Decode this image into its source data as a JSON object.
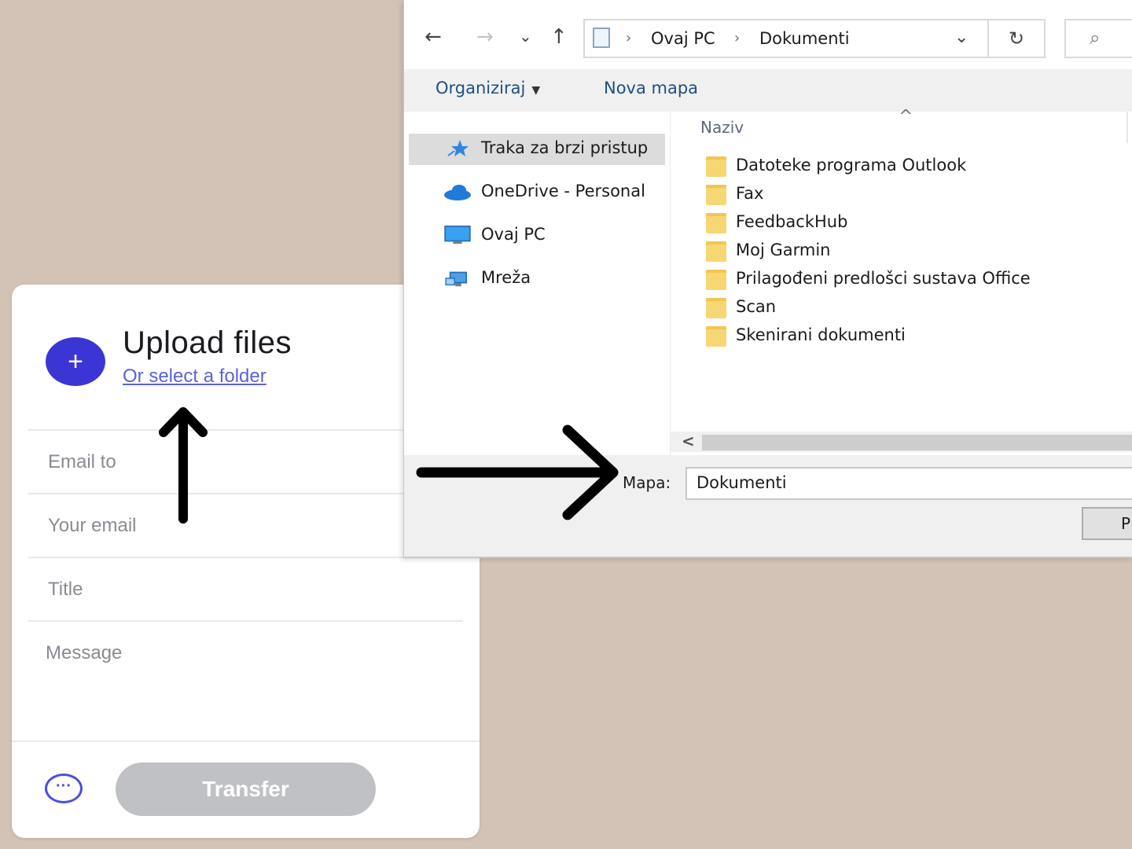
{
  "upload_card": {
    "plus_glyph": "+",
    "title": "Upload files",
    "folder_link": "Or select a folder",
    "fields": {
      "email_to": "Email to",
      "your_email": "Your email",
      "title": "Title",
      "message": "Message"
    },
    "more_glyph": "···",
    "transfer_label": "Transfer",
    "accent_color": "#3c35d6",
    "disabled_button_color": "#c0c1c5"
  },
  "dialog": {
    "nav_buttons": {
      "back": "←",
      "forward": "→",
      "recent": "⌄",
      "up": "↑"
    },
    "address": {
      "sep": "›",
      "segments": [
        "Ovaj PC",
        "Dokumenti"
      ],
      "dropdown": "⌄"
    },
    "refresh_glyph": "↻",
    "search_glyph": "⌕",
    "toolbar": {
      "organize": "Organiziraj",
      "organize_caret": "▼",
      "new_folder": "Nova mapa"
    },
    "nav_pane": [
      {
        "label": "Traka za brzi pristup",
        "icon": "star-icon"
      },
      {
        "label": "OneDrive - Personal",
        "icon": "cloud-icon"
      },
      {
        "label": "Ovaj PC",
        "icon": "monitor-icon"
      },
      {
        "label": "Mreža",
        "icon": "network-icon"
      }
    ],
    "file_list": {
      "column_header": "Naziv",
      "sort_glyph": "^",
      "items": [
        "Datoteke programa Outlook",
        "Fax",
        "FeedbackHub",
        "Moj Garmin",
        "Prilagođeni predlošci sustava Office",
        "Scan",
        "Skenirani dokumenti"
      ]
    },
    "scroll_left_glyph": "<",
    "folder_field": {
      "label": "Mapa:",
      "value": "Dokumenti"
    },
    "ok_button_visible": "P"
  }
}
